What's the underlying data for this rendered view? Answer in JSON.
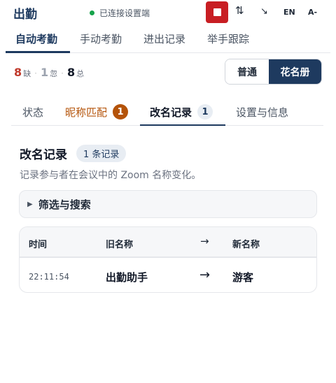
{
  "app": {
    "title": "出勤",
    "connection_status": "已连接设置端",
    "toolbar": {
      "swap_icon": "⇅",
      "minimize_icon": "↘",
      "lang_label": "EN",
      "font_label": "A-"
    }
  },
  "main_tabs": [
    {
      "label": "自动考勤",
      "active": true
    },
    {
      "label": "手动考勤",
      "active": false
    },
    {
      "label": "进出记录",
      "active": false
    },
    {
      "label": "举手跟踪",
      "active": false
    }
  ],
  "stats": {
    "absent": {
      "value": "8",
      "label": "缺"
    },
    "ignored": {
      "value": "1",
      "label": "忽"
    },
    "total": {
      "value": "8",
      "label": "总"
    }
  },
  "mode_toggle": {
    "options": [
      "普通",
      "花名册"
    ],
    "selected": "花名册"
  },
  "sub_tabs": [
    {
      "label": "状态"
    },
    {
      "label": "昵称匹配",
      "badge": "1"
    },
    {
      "label": "改名记录",
      "badge": "1",
      "active": true
    },
    {
      "label": "设置与信息"
    }
  ],
  "section": {
    "title": "改名记录",
    "count_label": "1 条记录",
    "description": "记录参与者在会议中的 Zoom 名称变化。"
  },
  "filter": {
    "label": "筛选与搜索",
    "icon": "triangle-right"
  },
  "table": {
    "columns": [
      "时间",
      "旧名称",
      "→",
      "新名称"
    ],
    "rows": [
      {
        "time": "22:11:54",
        "old_name": "出勤助手",
        "arrow": "→",
        "new_name": "游客"
      }
    ]
  },
  "colors": {
    "brand": "#1e3a5f",
    "stop": "#c81e23",
    "absent": "#c0392b",
    "ignored": "#9ca3af",
    "nickname_accent": "#b45309",
    "connected": "#16a34a"
  }
}
